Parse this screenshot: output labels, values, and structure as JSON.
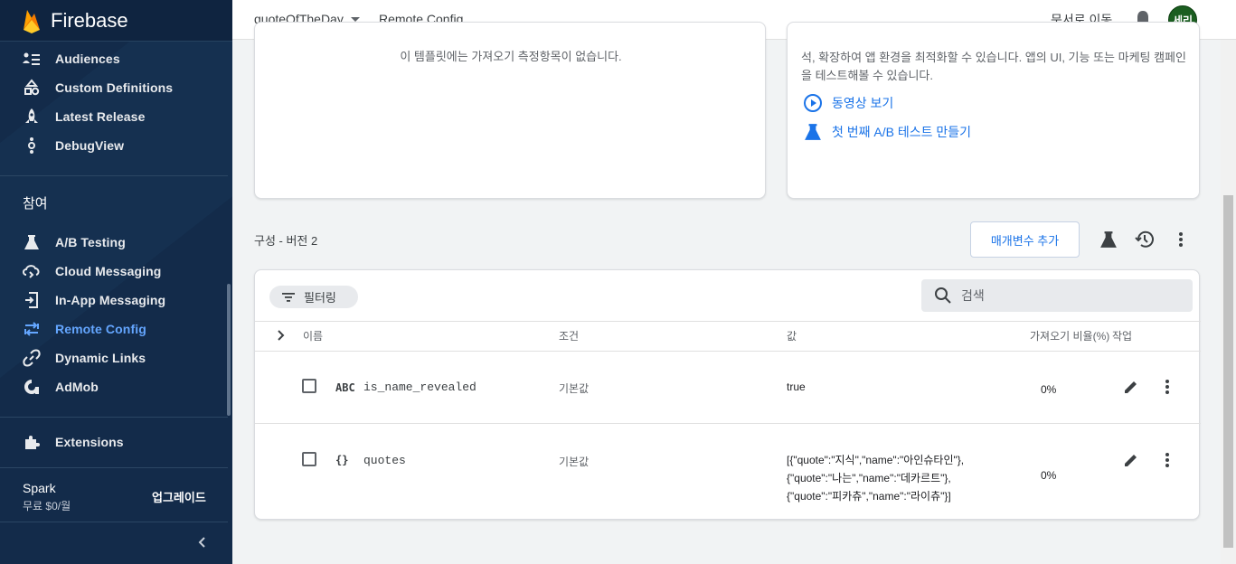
{
  "brand": {
    "name": "Firebase"
  },
  "sidebar": {
    "analytics_items": [
      {
        "label": "Audiences",
        "icon": "audiences-icon"
      },
      {
        "label": "Custom Definitions",
        "icon": "custom-definitions-icon"
      },
      {
        "label": "Latest Release",
        "icon": "latest-release-icon"
      },
      {
        "label": "DebugView",
        "icon": "debugview-icon"
      }
    ],
    "section_title": "참여",
    "engage_items": [
      {
        "label": "A/B Testing",
        "icon": "flask-icon"
      },
      {
        "label": "Cloud Messaging",
        "icon": "cloud-messaging-icon"
      },
      {
        "label": "In-App Messaging",
        "icon": "in-app-messaging-icon"
      },
      {
        "label": "Remote Config",
        "icon": "remote-config-icon",
        "active": true
      },
      {
        "label": "Dynamic Links",
        "icon": "link-icon"
      },
      {
        "label": "AdMob",
        "icon": "admob-icon"
      }
    ],
    "extensions": {
      "label": "Extensions",
      "icon": "extensions-icon"
    },
    "plan": {
      "name": "Spark",
      "price": "무료 $0/월",
      "upgrade_label": "업그레이드"
    }
  },
  "topbar": {
    "project": "quoteOfTheDay",
    "page_title": "Remote Config",
    "docs_label": "문서로 이동",
    "avatar_text": "세리"
  },
  "cards": {
    "left_message": "이 템플릿에는 가져오기 측정항목이 없습니다.",
    "right_description": "석, 확장하여 앱 환경을 최적화할 수 있습니다. 앱의 UI, 기능 또는 마케팅 캠페인을 테스트해볼 수 있습니다.",
    "watch_video": "동영상 보기",
    "create_ab_test": "첫 번째 A/B 테스트 만들기"
  },
  "config": {
    "version_label": "구성 - 버전 2",
    "add_param_label": "매개변수 추가"
  },
  "table": {
    "filter_label": "필터링",
    "search_placeholder": "검색",
    "headers": {
      "name": "이름",
      "condition": "조건",
      "value": "값",
      "fetch_rate": "가져오기 비율(%)",
      "actions": "작업"
    },
    "rows": [
      {
        "type": "ABC",
        "name": "is_name_revealed",
        "condition": "기본값",
        "value_lines": [
          "true"
        ],
        "fetch_rate": "0%"
      },
      {
        "type": "{}",
        "name": "quotes",
        "condition": "기본값",
        "value_lines": [
          "[{\"quote\":\"지식\",\"name\":\"아인슈타인\"},",
          "{\"quote\":\"나는\",\"name\":\"데카르트\"},",
          "{\"quote\":\"피카츄\",\"name\":\"라이츄\"}]"
        ],
        "fetch_rate": "0%"
      }
    ]
  },
  "colors": {
    "sidebar_bg": "#132b4a",
    "accent": "#1a73e8",
    "active_nav": "#64a6ff",
    "avatar_bg": "#1b5e20"
  }
}
